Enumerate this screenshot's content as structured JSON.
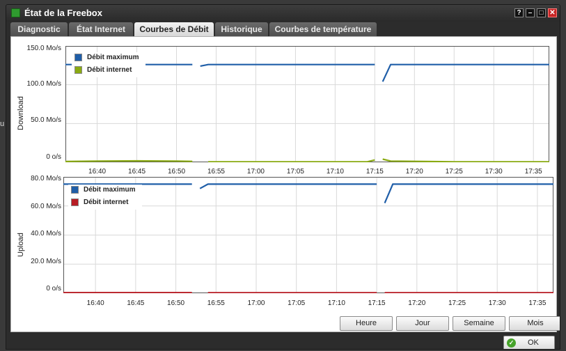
{
  "background": {
    "side_letter": "u"
  },
  "window": {
    "title": "État de la Freebox",
    "help_label": "?",
    "minimize_label": "–",
    "maximize_label": "□",
    "close_label": "✕"
  },
  "tabs": [
    {
      "label": "Diagnostic",
      "active": false
    },
    {
      "label": "État Internet",
      "active": false
    },
    {
      "label": "Courbes de Débit",
      "active": true
    },
    {
      "label": "Historique",
      "active": false
    },
    {
      "label": "Courbes de température",
      "active": false
    }
  ],
  "colors": {
    "max": "#1f5ea8",
    "download": "#8aaa12",
    "upload": "#b71c24",
    "grid": "#d9d9d9"
  },
  "chart_data": [
    {
      "type": "line",
      "ylabel": "Download",
      "ylim": [
        0,
        150
      ],
      "y_ticks": [
        "150.0 Mo/s",
        "100.0 Mo/s",
        "50.0 Mo/s",
        "0 o/s"
      ],
      "x_ticks": [
        "16:40",
        "16:45",
        "16:50",
        "16:55",
        "17:00",
        "17:05",
        "17:10",
        "17:15",
        "17:20",
        "17:25",
        "17:30",
        "17:35"
      ],
      "grid": true,
      "legend_position": "top-left",
      "series": [
        {
          "name": "Débit maximum",
          "segments": [
            [
              [
                "16:36",
                126
              ],
              [
                "16:52",
                126
              ]
            ],
            [
              [
                "16:53",
                124
              ],
              [
                "16:54",
                126
              ],
              [
                "17:15",
                126
              ]
            ],
            [
              [
                "17:16",
                104
              ],
              [
                "17:17",
                126
              ],
              [
                "17:37",
                126
              ]
            ]
          ]
        },
        {
          "name": "Débit internet",
          "segments": [
            [
              [
                "16:36",
                1.0
              ],
              [
                "16:40",
                1.5
              ],
              [
                "16:45",
                1.8
              ],
              [
                "16:50",
                1.5
              ],
              [
                "16:52",
                1.2
              ]
            ],
            [
              [
                "16:54",
                0.5
              ],
              [
                "17:00",
                0.5
              ],
              [
                "17:10",
                0.5
              ],
              [
                "17:14",
                0.5
              ],
              [
                "17:15",
                3
              ]
            ],
            [
              [
                "17:16",
                4
              ],
              [
                "17:17",
                1.5
              ],
              [
                "17:25",
                0.6
              ],
              [
                "17:37",
                0.5
              ]
            ]
          ]
        }
      ]
    },
    {
      "type": "line",
      "ylabel": "Upload",
      "ylim": [
        0,
        80
      ],
      "y_ticks": [
        "80.0 Mo/s",
        "60.0 Mo/s",
        "40.0 Mo/s",
        "20.0 Mo/s",
        "0 o/s"
      ],
      "x_ticks": [
        "16:40",
        "16:45",
        "16:50",
        "16:55",
        "17:00",
        "17:05",
        "17:10",
        "17:15",
        "17:20",
        "17:25",
        "17:30",
        "17:35"
      ],
      "grid": true,
      "legend_position": "top-left",
      "series": [
        {
          "name": "Débit maximum",
          "segments": [
            [
              [
                "16:36",
                75
              ],
              [
                "16:52",
                75
              ]
            ],
            [
              [
                "16:53",
                72
              ],
              [
                "16:54",
                75
              ],
              [
                "17:15",
                75
              ]
            ],
            [
              [
                "17:16",
                62
              ],
              [
                "17:17",
                75
              ],
              [
                "17:37",
                75
              ]
            ]
          ]
        },
        {
          "name": "Débit internet",
          "segments": [
            [
              [
                "16:36",
                0.4
              ],
              [
                "16:52",
                0.4
              ]
            ],
            [
              [
                "16:54",
                0.3
              ],
              [
                "17:15",
                0.3
              ]
            ],
            [
              [
                "17:16",
                0.3
              ],
              [
                "17:37",
                0.3
              ]
            ]
          ]
        }
      ]
    }
  ],
  "buttons": {
    "hour": "Heure",
    "day": "Jour",
    "week": "Semaine",
    "month": "Mois",
    "ok": "OK",
    "ok_icon": "✓"
  }
}
